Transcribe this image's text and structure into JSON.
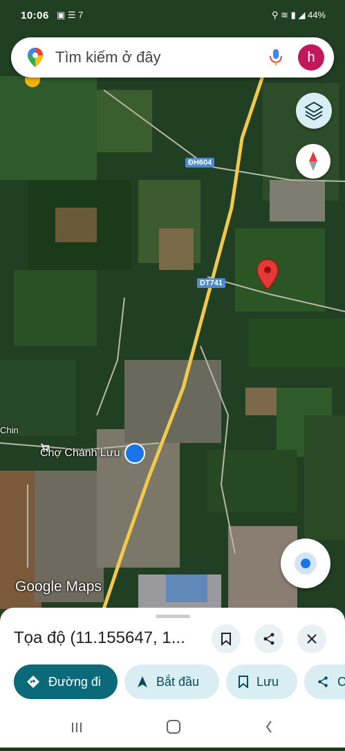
{
  "status_bar": {
    "time": "10:06",
    "notification_icons": "▣ ☰ 7",
    "right_icons": "⚲ ≋ ▮ ◢ 44%"
  },
  "search": {
    "placeholder": "Tìm kiếm ở đây",
    "avatar_letter": "h",
    "icons": [
      "maps-pin-icon",
      "mic-icon"
    ]
  },
  "map": {
    "road_labels": [
      "ĐH604",
      "DT741"
    ],
    "place_label": "Chợ Chánh Lưu",
    "edge_label": "Chin",
    "attribution": "Google Maps",
    "marker": "dropped-pin",
    "colors": {
      "marker": "#e53935",
      "road": "#f2c94c",
      "road_label": "#4a8ad6"
    }
  },
  "sheet": {
    "title": "Tọa độ (11.155647, 1...",
    "actions": {
      "directions": "Đường đi",
      "start": "Bắt đầu",
      "save": "Lưu",
      "share": "C"
    },
    "colors": {
      "primary": "#0b6a7a",
      "chip": "#d8eef3"
    }
  },
  "nav_bar": {
    "buttons": [
      "recent-apps",
      "home",
      "back"
    ]
  }
}
